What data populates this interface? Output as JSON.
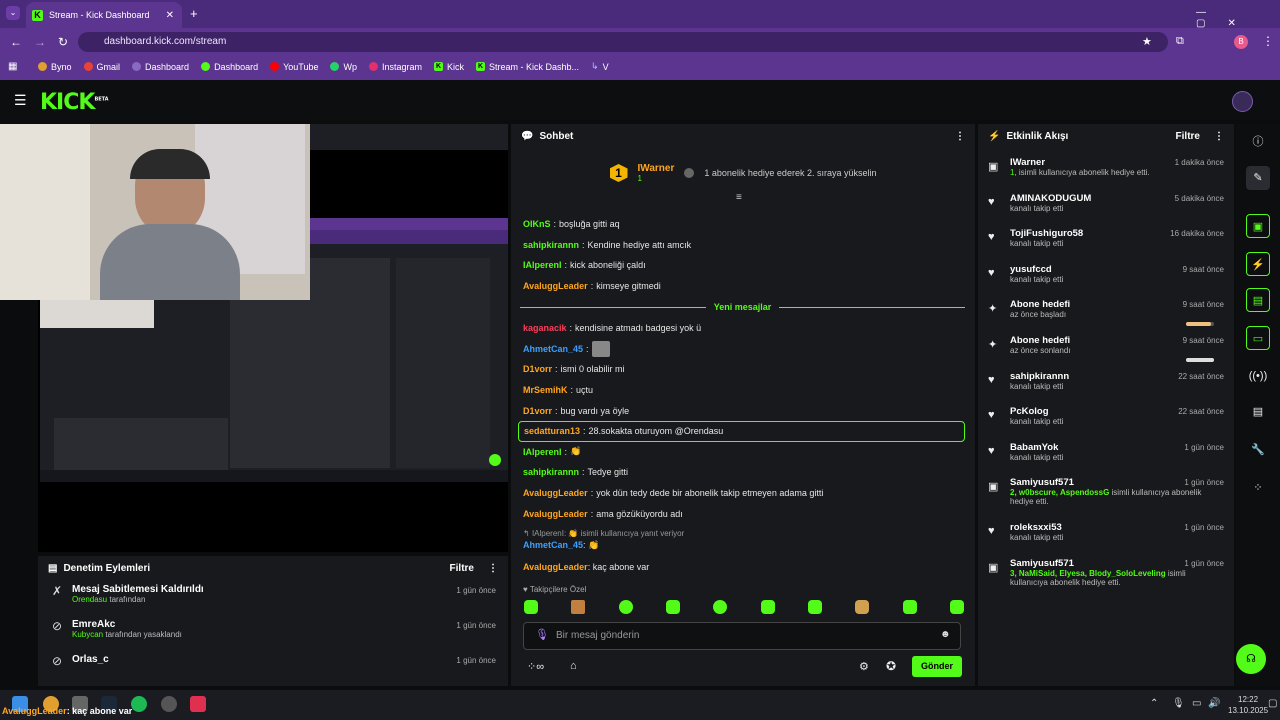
{
  "browser": {
    "tab_title": "Stream - Kick Dashboard",
    "url": "dashboard.kick.com/stream",
    "bookmarks": [
      "Byno",
      "Gmail",
      "Dashboard",
      "Dashboard",
      "YouTube",
      "Wp",
      "Instagram",
      "Kick",
      "Stream - Kick Dashb...",
      "V"
    ],
    "profile_initial": "B"
  },
  "header": {
    "logo": "KICK",
    "beta": "BETA"
  },
  "mod_panel": {
    "title": "Denetim Eylemleri",
    "filter": "Filtre",
    "items": [
      {
        "name": "Mesaj Sabitlemesi Kaldırıldı",
        "actor": "Orendasu",
        "action": "tarafından",
        "time": "1 gün önce"
      },
      {
        "name": "EmreAkc",
        "actor": "Kubycan",
        "action": "tarafından yasaklandı",
        "time": "1 gün önce"
      },
      {
        "name": "Orlas_c",
        "actor": "",
        "action": "",
        "time": "1 gün önce"
      }
    ]
  },
  "chat": {
    "title": "Sohbet",
    "pinned_user": "IWarner",
    "pinned_count": "1",
    "pinned_text": "1 abonelik hediye ederek 2. sıraya yükselin",
    "messages_before": [
      {
        "user": "OIKnS",
        "color": "#53fc18",
        "text": "boşluğa gitti aq"
      },
      {
        "user": "sahipkirannn",
        "color": "#53fc18",
        "text": "Kendine hediye attı amcık"
      },
      {
        "user": "IAlperenI",
        "color": "#53fc18",
        "text": "kick aboneliği çaldı"
      },
      {
        "user": "AvaluggLeader",
        "color": "#ffa620",
        "text": "kimseye gitmedi"
      }
    ],
    "new_messages_label": "Yeni mesajlar",
    "messages_after": [
      {
        "user": "kaganacik",
        "color": "#ff3c5a",
        "text": "kendisine atmadı badgesi yok ü"
      },
      {
        "user": "AhmetCan_45",
        "color": "#3ca0ff",
        "text": ""
      },
      {
        "user": "D1vorr",
        "color": "#ffa620",
        "text": "ismi 0 olabilir mi"
      },
      {
        "user": "MrSemihK",
        "color": "#ffa620",
        "text": "uçtu"
      },
      {
        "user": "D1vorr",
        "color": "#ffa620",
        "text": "bug vardı ya öyle"
      },
      {
        "user": "sedatturan13",
        "color": "#ffa620",
        "text": "28.sokakta oturuyom @Orendasu"
      },
      {
        "user": "IAlperenI",
        "color": "#53fc18",
        "text": ""
      },
      {
        "user": "sahipkirannn",
        "color": "#53fc18",
        "text": "Tedye gitti"
      },
      {
        "user": "AvaluggLeader",
        "color": "#ffa620",
        "text": "yok dün tedy dede bir abonelik takip etmeyen adama gitti"
      },
      {
        "user": "AvaluggLeader",
        "color": "#ffa620",
        "text": "ama gözüküyordu adı"
      }
    ],
    "reply_hint": "IAlperenI:",
    "reply_hint_tail": "isimli kullanıcıya yanıt veriyor",
    "reply_user": "AhmetCan_45",
    "last_msg": {
      "user": "AvaluggLeader",
      "color": "#ffa620",
      "text": "kaç abone var"
    },
    "followers_label": "Takipçilere Özel",
    "input_placeholder": "Bir mesaj gönderin",
    "send_label": "Gönder"
  },
  "activity": {
    "title": "Etkinlik Akışı",
    "filter": "Filtre",
    "items": [
      {
        "icon": "gift",
        "name": "IWarner",
        "sub_green": "1,",
        "sub": "isimli kullanıcıya abonelik hediye etti.",
        "time": "1 dakika önce"
      },
      {
        "icon": "heart",
        "name": "AMINAKODUGUM",
        "sub_green": "",
        "sub": "kanalı takip etti",
        "time": "5 dakika önce"
      },
      {
        "icon": "heart",
        "name": "TojiFushiguro58",
        "sub_green": "",
        "sub": "kanalı takip etti",
        "time": "16 dakika önce"
      },
      {
        "icon": "heart",
        "name": "yusufccd",
        "sub_green": "",
        "sub": "kanalı takip etti",
        "time": "9 saat önce"
      },
      {
        "icon": "sparkle",
        "name": "Abone hedefi",
        "sub_green": "",
        "sub": "az önce başladı",
        "time": "9 saat önce",
        "progress": 0.9
      },
      {
        "icon": "sparkle",
        "name": "Abone hedefi",
        "sub_green": "",
        "sub": "az önce sonlandı",
        "time": "9 saat önce",
        "progress": 1.0
      },
      {
        "icon": "heart",
        "name": "sahipkirannn",
        "sub_green": "",
        "sub": "kanalı takip etti",
        "time": "22 saat önce"
      },
      {
        "icon": "heart",
        "name": "PcKolog",
        "sub_green": "",
        "sub": "kanalı takip etti",
        "time": "22 saat önce"
      },
      {
        "icon": "heart",
        "name": "BabamYok",
        "sub_green": "",
        "sub": "kanalı takip etti",
        "time": "1 gün önce"
      },
      {
        "icon": "gift",
        "name": "Samiyusuf571",
        "sub_green": "2, w0bscure, AspendossG",
        "sub": "isimli kullanıcıya abonelik hediye etti.",
        "time": "1 gün önce"
      },
      {
        "icon": "heart",
        "name": "roleksxxi53",
        "sub_green": "",
        "sub": "kanalı takip etti",
        "time": "1 gün önce"
      },
      {
        "icon": "gift",
        "name": "Samiyusuf571",
        "sub_green": "3, NaMiSaid, Elyesa, Blody_SoloLeveling",
        "sub": "isimli kullanıcıya abonelik hediye etti.",
        "time": "1 gün önce"
      }
    ]
  },
  "taskbar": {
    "ticker_user": "AvaluggLeader",
    "ticker_text": ": kaç abone var",
    "time": "12:22",
    "date": "13.10.2025"
  },
  "colors": {
    "accent": "#53fc18",
    "browser": "#5c3590",
    "panel": "#18191c"
  }
}
